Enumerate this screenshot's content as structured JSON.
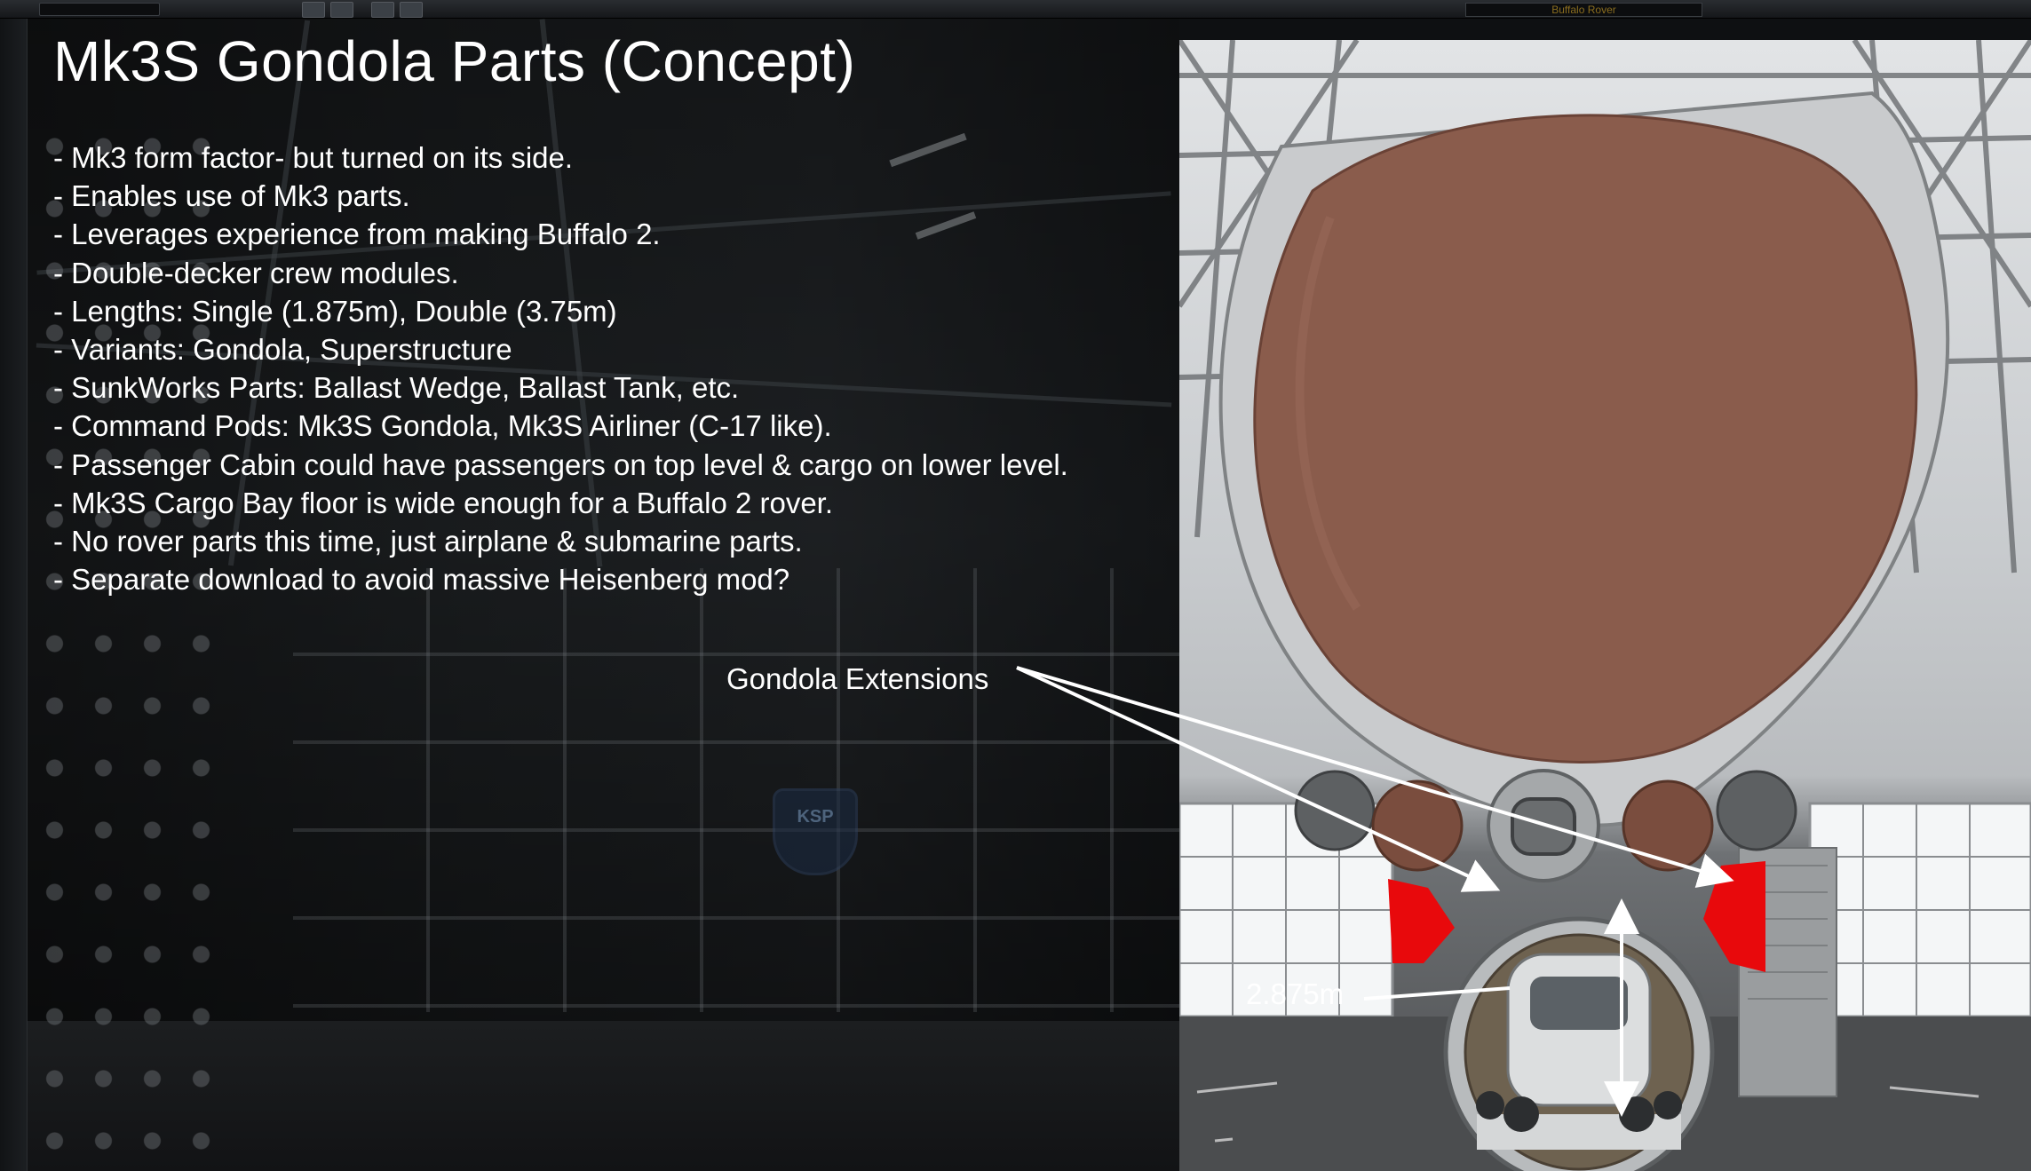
{
  "editor": {
    "vessel_name": "Buffalo Rover"
  },
  "slide": {
    "title": "Mk3S Gondola Parts (Concept)",
    "bullets": [
      "- Mk3 form factor- but turned on its side.",
      "- Enables use of Mk3 parts.",
      "- Leverages experience from making Buffalo 2.",
      "- Double-decker crew modules.",
      "- Lengths: Single (1.875m), Double (3.75m)",
      "- Variants: Gondola, Superstructure",
      "- SunkWorks Parts: Ballast Wedge, Ballast Tank, etc.",
      "- Command Pods: Mk3S Gondola, Mk3S Airliner (C-17 like).",
      "- Passenger Cabin could have passengers on top level & cargo on lower level.",
      "- Mk3S Cargo Bay floor is wide enough for a Buffalo 2 rover.",
      "- No rover parts this time, just airplane & submarine parts.",
      "- Separate download to avoid massive Heisenberg mod?"
    ],
    "callouts": {
      "extensions": "Gondola Extensions",
      "dimension": "2.875m"
    },
    "logo_text": "KSP"
  },
  "colors": {
    "envelope": "#8a5c4c",
    "hull": "#c9cbcd",
    "extension_red": "#e8090c",
    "arrow": "#ffffff"
  }
}
